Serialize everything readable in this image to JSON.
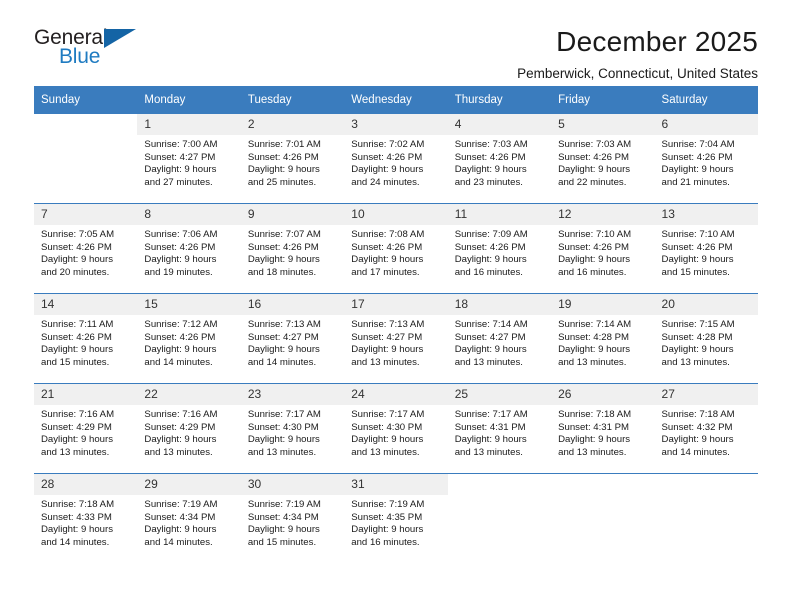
{
  "brand": {
    "name_part1": "General",
    "name_part2": "Blue",
    "accent_color": "#1f7bc1",
    "triangle_color": "#1464a5"
  },
  "header": {
    "title": "December 2025",
    "location": "Pemberwick, Connecticut, United States"
  },
  "calendar": {
    "header_bg": "#3a7cbe",
    "daynum_bg": "#f0f0f0",
    "weekdays": [
      "Sunday",
      "Monday",
      "Tuesday",
      "Wednesday",
      "Thursday",
      "Friday",
      "Saturday"
    ],
    "weeks": [
      [
        {
          "day": "",
          "blank": true,
          "sunrise": "",
          "sunset": "",
          "daylight1": "",
          "daylight2": ""
        },
        {
          "day": "1",
          "sunrise": "Sunrise: 7:00 AM",
          "sunset": "Sunset: 4:27 PM",
          "daylight1": "Daylight: 9 hours",
          "daylight2": "and 27 minutes."
        },
        {
          "day": "2",
          "sunrise": "Sunrise: 7:01 AM",
          "sunset": "Sunset: 4:26 PM",
          "daylight1": "Daylight: 9 hours",
          "daylight2": "and 25 minutes."
        },
        {
          "day": "3",
          "sunrise": "Sunrise: 7:02 AM",
          "sunset": "Sunset: 4:26 PM",
          "daylight1": "Daylight: 9 hours",
          "daylight2": "and 24 minutes."
        },
        {
          "day": "4",
          "sunrise": "Sunrise: 7:03 AM",
          "sunset": "Sunset: 4:26 PM",
          "daylight1": "Daylight: 9 hours",
          "daylight2": "and 23 minutes."
        },
        {
          "day": "5",
          "sunrise": "Sunrise: 7:03 AM",
          "sunset": "Sunset: 4:26 PM",
          "daylight1": "Daylight: 9 hours",
          "daylight2": "and 22 minutes."
        },
        {
          "day": "6",
          "sunrise": "Sunrise: 7:04 AM",
          "sunset": "Sunset: 4:26 PM",
          "daylight1": "Daylight: 9 hours",
          "daylight2": "and 21 minutes."
        }
      ],
      [
        {
          "day": "7",
          "sunrise": "Sunrise: 7:05 AM",
          "sunset": "Sunset: 4:26 PM",
          "daylight1": "Daylight: 9 hours",
          "daylight2": "and 20 minutes."
        },
        {
          "day": "8",
          "sunrise": "Sunrise: 7:06 AM",
          "sunset": "Sunset: 4:26 PM",
          "daylight1": "Daylight: 9 hours",
          "daylight2": "and 19 minutes."
        },
        {
          "day": "9",
          "sunrise": "Sunrise: 7:07 AM",
          "sunset": "Sunset: 4:26 PM",
          "daylight1": "Daylight: 9 hours",
          "daylight2": "and 18 minutes."
        },
        {
          "day": "10",
          "sunrise": "Sunrise: 7:08 AM",
          "sunset": "Sunset: 4:26 PM",
          "daylight1": "Daylight: 9 hours",
          "daylight2": "and 17 minutes."
        },
        {
          "day": "11",
          "sunrise": "Sunrise: 7:09 AM",
          "sunset": "Sunset: 4:26 PM",
          "daylight1": "Daylight: 9 hours",
          "daylight2": "and 16 minutes."
        },
        {
          "day": "12",
          "sunrise": "Sunrise: 7:10 AM",
          "sunset": "Sunset: 4:26 PM",
          "daylight1": "Daylight: 9 hours",
          "daylight2": "and 16 minutes."
        },
        {
          "day": "13",
          "sunrise": "Sunrise: 7:10 AM",
          "sunset": "Sunset: 4:26 PM",
          "daylight1": "Daylight: 9 hours",
          "daylight2": "and 15 minutes."
        }
      ],
      [
        {
          "day": "14",
          "sunrise": "Sunrise: 7:11 AM",
          "sunset": "Sunset: 4:26 PM",
          "daylight1": "Daylight: 9 hours",
          "daylight2": "and 15 minutes."
        },
        {
          "day": "15",
          "sunrise": "Sunrise: 7:12 AM",
          "sunset": "Sunset: 4:26 PM",
          "daylight1": "Daylight: 9 hours",
          "daylight2": "and 14 minutes."
        },
        {
          "day": "16",
          "sunrise": "Sunrise: 7:13 AM",
          "sunset": "Sunset: 4:27 PM",
          "daylight1": "Daylight: 9 hours",
          "daylight2": "and 14 minutes."
        },
        {
          "day": "17",
          "sunrise": "Sunrise: 7:13 AM",
          "sunset": "Sunset: 4:27 PM",
          "daylight1": "Daylight: 9 hours",
          "daylight2": "and 13 minutes."
        },
        {
          "day": "18",
          "sunrise": "Sunrise: 7:14 AM",
          "sunset": "Sunset: 4:27 PM",
          "daylight1": "Daylight: 9 hours",
          "daylight2": "and 13 minutes."
        },
        {
          "day": "19",
          "sunrise": "Sunrise: 7:14 AM",
          "sunset": "Sunset: 4:28 PM",
          "daylight1": "Daylight: 9 hours",
          "daylight2": "and 13 minutes."
        },
        {
          "day": "20",
          "sunrise": "Sunrise: 7:15 AM",
          "sunset": "Sunset: 4:28 PM",
          "daylight1": "Daylight: 9 hours",
          "daylight2": "and 13 minutes."
        }
      ],
      [
        {
          "day": "21",
          "sunrise": "Sunrise: 7:16 AM",
          "sunset": "Sunset: 4:29 PM",
          "daylight1": "Daylight: 9 hours",
          "daylight2": "and 13 minutes."
        },
        {
          "day": "22",
          "sunrise": "Sunrise: 7:16 AM",
          "sunset": "Sunset: 4:29 PM",
          "daylight1": "Daylight: 9 hours",
          "daylight2": "and 13 minutes."
        },
        {
          "day": "23",
          "sunrise": "Sunrise: 7:17 AM",
          "sunset": "Sunset: 4:30 PM",
          "daylight1": "Daylight: 9 hours",
          "daylight2": "and 13 minutes."
        },
        {
          "day": "24",
          "sunrise": "Sunrise: 7:17 AM",
          "sunset": "Sunset: 4:30 PM",
          "daylight1": "Daylight: 9 hours",
          "daylight2": "and 13 minutes."
        },
        {
          "day": "25",
          "sunrise": "Sunrise: 7:17 AM",
          "sunset": "Sunset: 4:31 PM",
          "daylight1": "Daylight: 9 hours",
          "daylight2": "and 13 minutes."
        },
        {
          "day": "26",
          "sunrise": "Sunrise: 7:18 AM",
          "sunset": "Sunset: 4:31 PM",
          "daylight1": "Daylight: 9 hours",
          "daylight2": "and 13 minutes."
        },
        {
          "day": "27",
          "sunrise": "Sunrise: 7:18 AM",
          "sunset": "Sunset: 4:32 PM",
          "daylight1": "Daylight: 9 hours",
          "daylight2": "and 14 minutes."
        }
      ],
      [
        {
          "day": "28",
          "sunrise": "Sunrise: 7:18 AM",
          "sunset": "Sunset: 4:33 PM",
          "daylight1": "Daylight: 9 hours",
          "daylight2": "and 14 minutes."
        },
        {
          "day": "29",
          "sunrise": "Sunrise: 7:19 AM",
          "sunset": "Sunset: 4:34 PM",
          "daylight1": "Daylight: 9 hours",
          "daylight2": "and 14 minutes."
        },
        {
          "day": "30",
          "sunrise": "Sunrise: 7:19 AM",
          "sunset": "Sunset: 4:34 PM",
          "daylight1": "Daylight: 9 hours",
          "daylight2": "and 15 minutes."
        },
        {
          "day": "31",
          "sunrise": "Sunrise: 7:19 AM",
          "sunset": "Sunset: 4:35 PM",
          "daylight1": "Daylight: 9 hours",
          "daylight2": "and 16 minutes."
        },
        {
          "day": "",
          "blank": true,
          "sunrise": "",
          "sunset": "",
          "daylight1": "",
          "daylight2": ""
        },
        {
          "day": "",
          "blank": true,
          "sunrise": "",
          "sunset": "",
          "daylight1": "",
          "daylight2": ""
        },
        {
          "day": "",
          "blank": true,
          "sunrise": "",
          "sunset": "",
          "daylight1": "",
          "daylight2": ""
        }
      ]
    ]
  }
}
